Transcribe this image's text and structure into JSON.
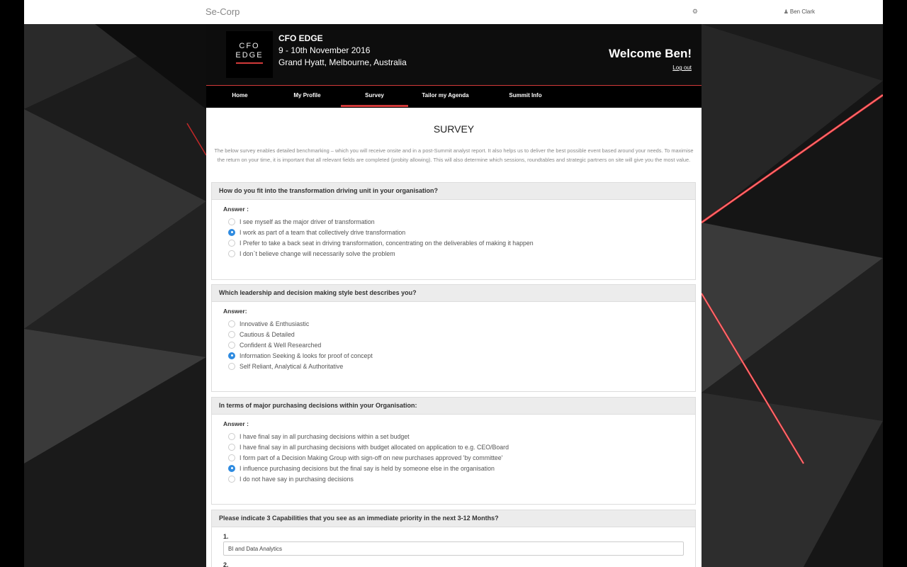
{
  "topbar": {
    "brand": "Se-Corp",
    "user_name": "Ben Clark"
  },
  "event": {
    "logo_line1": "CFO",
    "logo_line2": "EDGE",
    "title": "CFO EDGE",
    "dates": "9 - 10th November 2016",
    "venue": "Grand Hyatt, Melbourne, Australia",
    "welcome": "Welcome Ben!",
    "logout": "Log out"
  },
  "nav": {
    "tabs": [
      {
        "label": "Home"
      },
      {
        "label": "My Profile"
      },
      {
        "label": "Survey"
      },
      {
        "label": "Tailor my Agenda"
      },
      {
        "label": "Summit Info"
      }
    ],
    "active": "Survey"
  },
  "survey": {
    "title": "SURVEY",
    "intro": "The below survey enables detailed benchmarking – which you will receive onsite and in a post-Summit analyst report. It also helps us to deliver the best possible event based around your needs.  To maximise the return on your time, it is important that all relevant fields are completed (probity allowing).  This will also determine which sessions, roundtables and strategic partners on site will give you the most value.",
    "questions": [
      {
        "question": "How do you fit into the transformation driving unit in your organisation?",
        "answer_label": "Answer :",
        "options": [
          "I see myself as the major driver of transformation",
          "I work as part of a team that collectively drive transformation",
          "I Prefer to take a back seat in driving transformation, concentrating on the deliverables of making it happen",
          "I don`t believe change will necessarily solve the problem"
        ],
        "selected": 1
      },
      {
        "question": "Which leadership and decision making style best describes you?",
        "answer_label": "Answer:",
        "options": [
          "Innovative & Enthusiastic",
          "Cautious & Detailed",
          "Confident & Well Researched",
          "Information Seeking & looks for proof of concept",
          "Self Reliant, Analytical & Authoritative"
        ],
        "selected": 3
      },
      {
        "question": "In terms of major purchasing decisions within your Organisation:",
        "answer_label": "Answer :",
        "options": [
          "I have final say in all purchasing decisions within a set budget",
          "I have final say in all purchasing decisions with budget allocated on application to e.g. CEO/Board",
          "I form part of a Decision Making Group with sign-off on new purchases approved 'by committee'",
          "I influence purchasing decisions but the final say is held by someone else in the organisation",
          "I do not have say in purchasing decisions"
        ],
        "selected": 3
      },
      {
        "question": "Please indicate 3 Capabilities that you see as an immediate priority in the next 3-12 Months?",
        "items": [
          {
            "number": "1.",
            "value": "BI and Data Analytics"
          },
          {
            "number": "2.",
            "value": ""
          }
        ]
      }
    ]
  },
  "colors": {
    "accent": "#d23a3a",
    "radio_selected": "#2f8be0"
  }
}
